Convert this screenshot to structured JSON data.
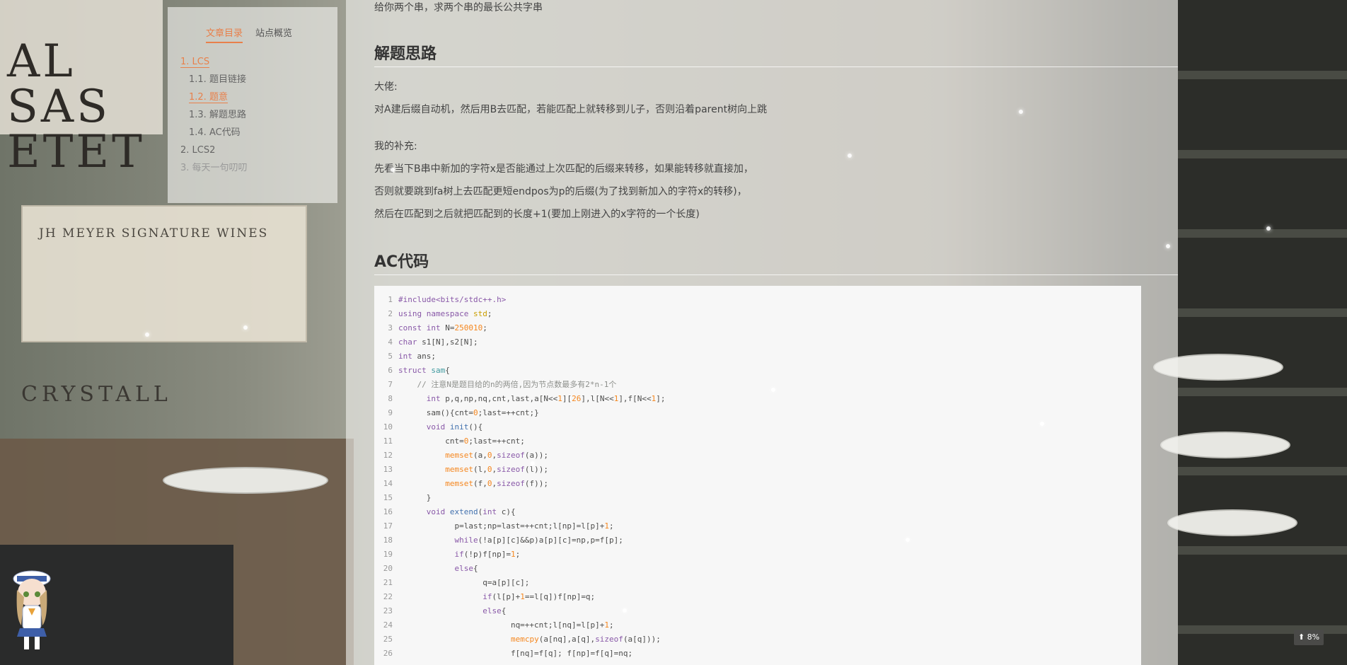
{
  "background": {
    "sign_big": "AL\nSAS\nETET",
    "crate_text": "JH MEYER SIGNATURE WINES",
    "crystal_text": "CRYSTALL"
  },
  "toc": {
    "tabs": [
      {
        "label": "文章目录",
        "active": true
      },
      {
        "label": "站点概览",
        "active": false
      }
    ],
    "items": [
      {
        "label": "1. LCS",
        "level": 1,
        "state": "on"
      },
      {
        "label": "1.1. 题目链接",
        "level": 2,
        "state": "normal"
      },
      {
        "label": "1.2. 题意",
        "level": 2,
        "state": "on"
      },
      {
        "label": "1.3. 解题思路",
        "level": 2,
        "state": "normal"
      },
      {
        "label": "1.4. AC代码",
        "level": 2,
        "state": "normal"
      },
      {
        "label": "2. LCS2",
        "level": 1,
        "state": "normal"
      },
      {
        "label": "3. 每天一句叨叨",
        "level": 1,
        "state": "dim"
      }
    ]
  },
  "article": {
    "intro": "给你两个串，求两个串的最长公共字串",
    "heading_idea": "解题思路",
    "boss_label": "大佬:",
    "boss_text": "对A建后缀自动机，然后用B去匹配，若能匹配上就转移到儿子，否则沿着parent树向上跳",
    "mine_label": "我的补充:",
    "mine_lines": [
      "先看当下B串中新加的字符x是否能通过上次匹配的后缀来转移，如果能转移就直接加，",
      "否则就要跳到fa树上去匹配更短endpos为p的后缀(为了找到新加入的字符x的转移)，",
      "然后在匹配到之后就把匹配到的长度+1(要加上刚进入的x字符的一个长度)"
    ],
    "heading_code": "AC代码"
  },
  "code_lines": [
    {
      "n": "1",
      "html": "<span class=\"pp\">#include&lt;bits/stdc++.h&gt;</span>"
    },
    {
      "n": "2",
      "html": "<span class=\"kw\">using</span> <span class=\"kw\">namespace</span> <span class=\"ty\">std</span>;"
    },
    {
      "n": "3",
      "html": "<span class=\"kw\">const</span> <span class=\"kw\">int</span> N=<span class=\"nm\">250010</span>;"
    },
    {
      "n": "4",
      "html": "<span class=\"kw\">char</span> s1[N],s2[N];"
    },
    {
      "n": "5",
      "html": "<span class=\"kw\">int</span> ans;"
    },
    {
      "n": "6",
      "html": "<span class=\"kw\">struct</span> <span class=\"tp\">sam</span>{"
    },
    {
      "n": "7",
      "html": "    <span class=\"cm\">// 注意N是题目给的n的两倍,因为节点数最多有2*n-1个</span>"
    },
    {
      "n": "8",
      "html": "      <span class=\"kw\">int</span> p,q,np,nq,cnt,last,a[N&lt;&lt;<span class=\"nm\">1</span>][<span class=\"nm\">26</span>],l[N&lt;&lt;<span class=\"nm\">1</span>],f[N&lt;&lt;<span class=\"nm\">1</span>];"
    },
    {
      "n": "9",
      "html": "      sam(){cnt=<span class=\"nm\">0</span>;last=++cnt;}"
    },
    {
      "n": "10",
      "html": "      <span class=\"kw\">void</span> <span class=\"fn\">init</span>(){"
    },
    {
      "n": "11",
      "html": "          cnt=<span class=\"nm\">0</span>;last=++cnt;"
    },
    {
      "n": "12",
      "html": "          <span class=\"bi\">memset</span>(a,<span class=\"nm\">0</span>,<span class=\"kw\">sizeof</span>(a));"
    },
    {
      "n": "13",
      "html": "          <span class=\"bi\">memset</span>(l,<span class=\"nm\">0</span>,<span class=\"kw\">sizeof</span>(l));"
    },
    {
      "n": "14",
      "html": "          <span class=\"bi\">memset</span>(f,<span class=\"nm\">0</span>,<span class=\"kw\">sizeof</span>(f));"
    },
    {
      "n": "15",
      "html": "      }"
    },
    {
      "n": "16",
      "html": "      <span class=\"kw\">void</span> <span class=\"fn\">extend</span>(<span class=\"kw\">int</span> c){"
    },
    {
      "n": "17",
      "html": "            p=last;np=last=++cnt;l[np]=l[p]+<span class=\"nm\">1</span>;"
    },
    {
      "n": "18",
      "html": "            <span class=\"kw\">while</span>(!a[p][c]&amp;&amp;p)a[p][c]=np,p=f[p];"
    },
    {
      "n": "19",
      "html": "            <span class=\"kw\">if</span>(!p)f[np]=<span class=\"nm\">1</span>;"
    },
    {
      "n": "20",
      "html": "            <span class=\"kw\">else</span>{"
    },
    {
      "n": "21",
      "html": "                  q=a[p][c];"
    },
    {
      "n": "22",
      "html": "                  <span class=\"kw\">if</span>(l[p]+<span class=\"nm\">1</span>==l[q])f[np]=q;"
    },
    {
      "n": "23",
      "html": "                  <span class=\"kw\">else</span>{"
    },
    {
      "n": "24",
      "html": "                        nq=++cnt;l[nq]=l[p]+<span class=\"nm\">1</span>;"
    },
    {
      "n": "25",
      "html": "                        <span class=\"bi\">memcpy</span>(a[nq],a[q],<span class=\"kw\">sizeof</span>(a[q]));"
    },
    {
      "n": "26",
      "html": "                        f[nq]=f[q]; f[np]=f[q]=nq;"
    }
  ],
  "back_to_top": {
    "icon": "arrow-up-icon",
    "glyph": "⬆",
    "label": "8%"
  },
  "colors": {
    "accent": "#e8804b"
  }
}
